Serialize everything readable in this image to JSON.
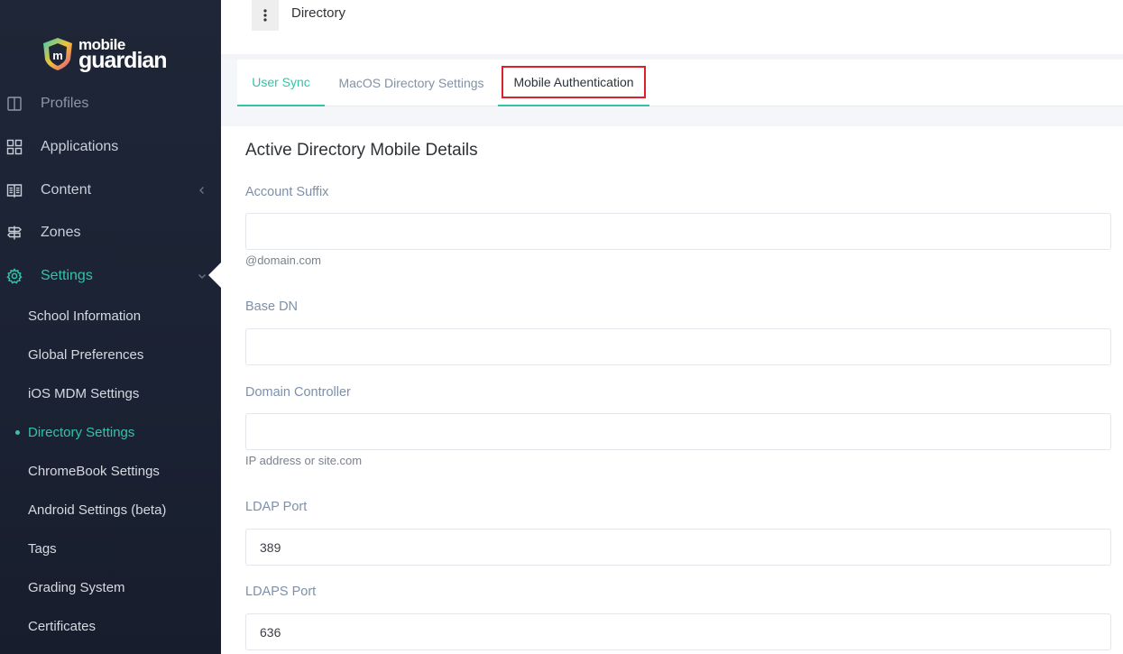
{
  "brand": {
    "line1": "mobile",
    "line2": "guardian",
    "accent": "#33c3a8"
  },
  "sidebar": {
    "items": [
      {
        "label": "Profiles",
        "icon": "profiles-icon"
      },
      {
        "label": "Applications",
        "icon": "grid-icon"
      },
      {
        "label": "Content",
        "icon": "book-icon"
      },
      {
        "label": "Zones",
        "icon": "signpost-icon"
      },
      {
        "label": "Settings",
        "icon": "gear-icon"
      }
    ],
    "sub_items": [
      "School Information",
      "Global Preferences",
      "iOS MDM Settings",
      "Directory Settings",
      "ChromeBook Settings",
      "Android Settings (beta)",
      "Tags",
      "Grading System",
      "Certificates"
    ]
  },
  "header": {
    "title": "Directory"
  },
  "tabs": [
    {
      "label": "User Sync"
    },
    {
      "label": "MacOS Directory Settings"
    },
    {
      "label": "Mobile Authentication"
    }
  ],
  "form": {
    "title": "Active Directory Mobile Details",
    "account_suffix": {
      "label": "Account Suffix",
      "value": "",
      "help": "@domain.com"
    },
    "base_dn": {
      "label": "Base DN",
      "value": ""
    },
    "domain_controller": {
      "label": "Domain Controller",
      "value": "",
      "help": "IP address or site.com"
    },
    "ldap_port": {
      "label": "LDAP Port",
      "value": "389"
    },
    "ldaps_port": {
      "label": "LDAPS Port",
      "value": "636"
    }
  }
}
